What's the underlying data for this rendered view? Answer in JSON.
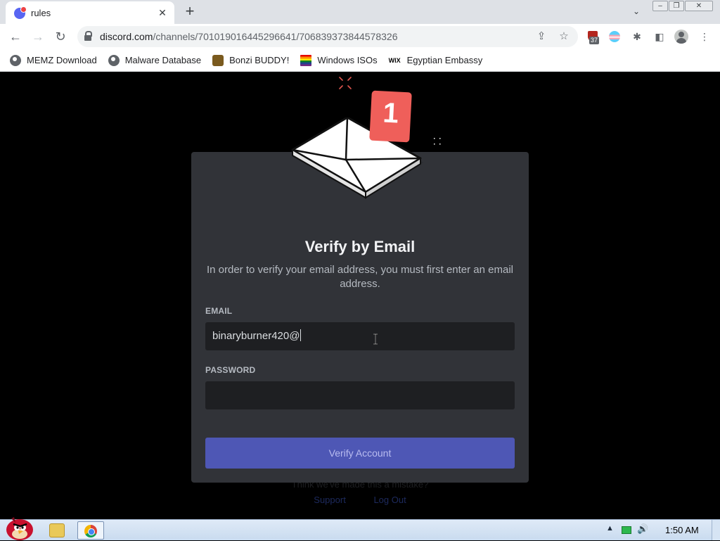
{
  "browser": {
    "tab_title": "rules",
    "tab_close": "✕",
    "new_tab": "+",
    "tab_search": "⌄",
    "window_controls": {
      "minimize": "–",
      "restore": "❐",
      "close": "✕"
    },
    "nav": {
      "back": "←",
      "forward": "→",
      "reload": "↻"
    },
    "url_host": "discord.com",
    "url_path": "/channels/701019016445296641/706839373844578326",
    "extension_badge_count": "37",
    "bookmarks": [
      {
        "label": "MEMZ Download",
        "icon": "globe-icon"
      },
      {
        "label": "Malware Database",
        "icon": "globe-icon"
      },
      {
        "label": "Bonzi BUDDY!",
        "icon": "bonzi-icon"
      },
      {
        "label": "Windows ISOs",
        "icon": "rainbow-flag-icon"
      },
      {
        "label": "Egyptian Embassy",
        "icon": "wix-icon"
      }
    ]
  },
  "modal": {
    "notification_count": "1",
    "title": "Verify by Email",
    "description": "In order to verify your email address, you must first enter an email address.",
    "email_label": "EMAIL",
    "email_value": "binaryburner420@",
    "password_label": "PASSWORD",
    "password_value": "",
    "submit_label": "Verify Account"
  },
  "background": {
    "text": "Think we've made this a mistake?",
    "links": [
      "Support",
      "Log Out"
    ]
  },
  "taskbar": {
    "clock": "1:50 AM",
    "tray_arrow": "▲"
  },
  "colors": {
    "modal_bg": "#313338",
    "input_bg": "#1e1f22",
    "button_bg": "#4e57b5",
    "badge_red": "#ef5f5a"
  }
}
